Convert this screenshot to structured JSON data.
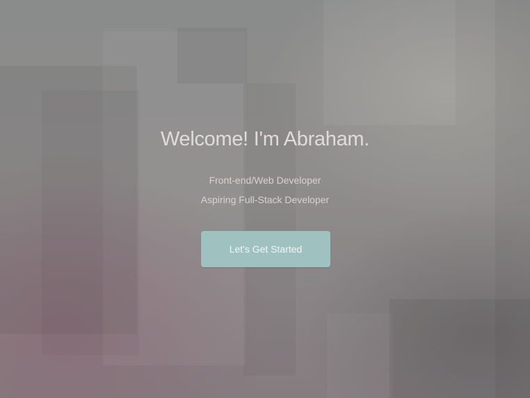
{
  "hero": {
    "title": "Welcome! I'm Abraham.",
    "subtitle_lines": [
      "Front-end/Web Developer",
      "Aspiring Full-Stack Developer"
    ],
    "cta_label": "Let's Get Started"
  },
  "colors": {
    "button_bg": "#9fc2c1",
    "text": "#e0dcda"
  }
}
